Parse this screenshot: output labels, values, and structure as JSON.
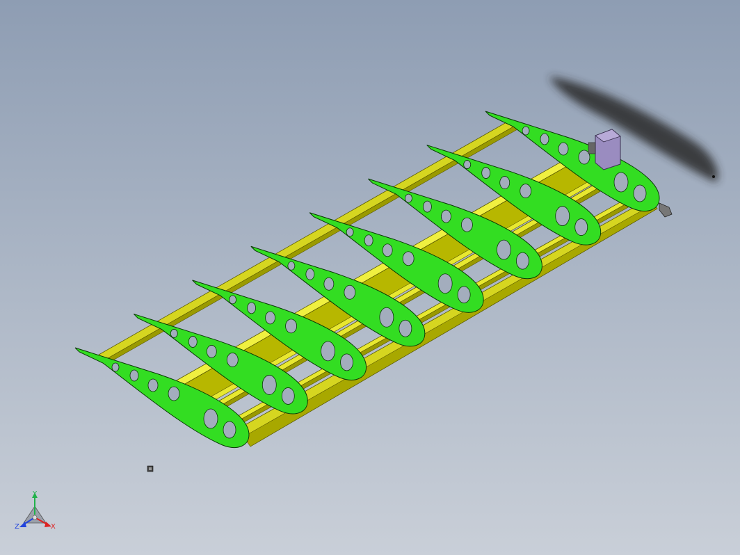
{
  "viewport": {
    "background_top": "#8e9db3",
    "background_bottom": "#c9cfd8"
  },
  "model": {
    "rib_color": "#33dd22",
    "rib_edge_color": "#0a3a06",
    "spar_color": "#e8e830",
    "spar_shadow_color": "#b4b400",
    "servo_color": "#9a8cc0",
    "propeller_color": "#222222",
    "rib_count": 8
  },
  "triad": {
    "y_label": "Y",
    "z_label": "Z",
    "x_label": "X",
    "y_color": "#21b24a",
    "z_color": "#2244dd",
    "x_color": "#dd2222"
  }
}
